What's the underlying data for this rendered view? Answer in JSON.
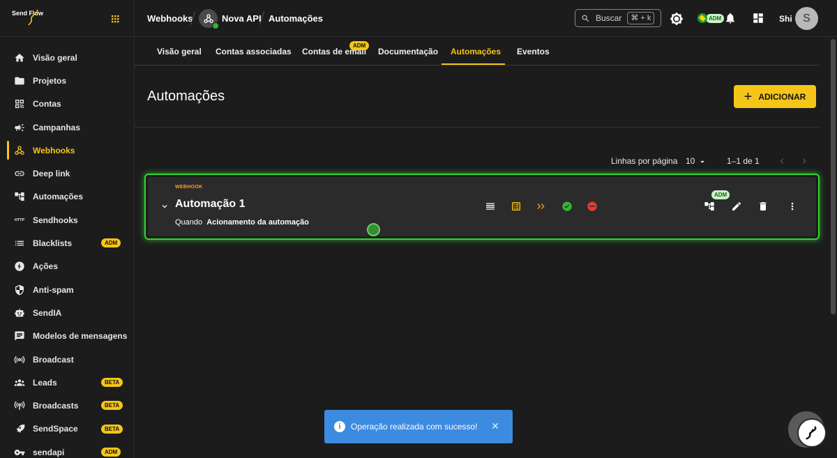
{
  "brand": {
    "logo_text": "Send Flow"
  },
  "sidebar": {
    "items": [
      {
        "label": "Visão geral",
        "icon": "home-icon"
      },
      {
        "label": "Projetos",
        "icon": "folder-icon"
      },
      {
        "label": "Contas",
        "icon": "qr-icon"
      },
      {
        "label": "Campanhas",
        "icon": "megaphone-icon"
      },
      {
        "label": "Webhooks",
        "icon": "webhook-icon",
        "active": true
      },
      {
        "label": "Deep link",
        "icon": "link-icon"
      },
      {
        "label": "Automações",
        "icon": "automation-icon"
      },
      {
        "label": "Sendhooks",
        "icon": "http-icon",
        "icon_text": "HTTP"
      },
      {
        "label": "Blacklists",
        "icon": "list-icon",
        "badge": "ADM"
      },
      {
        "label": "Ações",
        "icon": "bolt-icon"
      },
      {
        "label": "Anti-spam",
        "icon": "shield-icon"
      },
      {
        "label": "SendIA",
        "icon": "robot-icon"
      },
      {
        "label": "Modelos de mensagens",
        "icon": "message-icon"
      },
      {
        "label": "Broadcast",
        "icon": "broadcast-icon"
      },
      {
        "label": "Leads",
        "icon": "people-icon",
        "badge": "BETA"
      },
      {
        "label": "Broadcasts",
        "icon": "broadcasts-icon",
        "badge": "BETA"
      },
      {
        "label": "SendSpace",
        "icon": "rocket-icon",
        "badge": "BETA"
      },
      {
        "label": "sendapi",
        "icon": "key-icon",
        "badge": "ADM"
      }
    ]
  },
  "topbar": {
    "crumb_1": "Webhooks",
    "crumb_2": "Nova API",
    "crumb_3": "Automações",
    "search_label": "Buscar",
    "search_shortcut": "⌘ + k",
    "admin_badge": "ADM",
    "user_name": "Shi",
    "user_initial": "S"
  },
  "tabs": {
    "items": [
      "Visão geral",
      "Contas associadas",
      "Contas de email",
      "Documentação",
      "Automações",
      "Eventos"
    ],
    "active_index": 4,
    "email_badge": "ADM"
  },
  "page": {
    "title": "Automações",
    "add_button": "ADICIONAR"
  },
  "pagination": {
    "rows_label": "Linhas por página",
    "rows_value": "10",
    "range": "1–1 de 1"
  },
  "automation": {
    "type": "WEBHOOK",
    "name": "Automação 1",
    "when_label": "Quando",
    "trigger": "Acionamento da automação",
    "admin_badge": "ADM"
  },
  "toast": {
    "message": "Operação realizada com sucesso!"
  },
  "colors": {
    "accent": "#f5c518",
    "success": "#33d633",
    "toast": "#3d8be0",
    "warning": "#ff9a2e",
    "danger": "#e53935"
  }
}
